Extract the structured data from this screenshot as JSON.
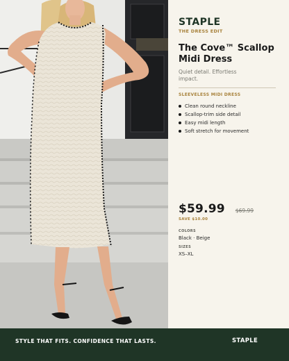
{
  "brand": "STAPLE",
  "edit_label": "THE DRESS EDIT",
  "product": {
    "title": "The Cove™ Scallop Midi Dress",
    "tagline": "Quiet detail. Effortless impact.",
    "category": "SLEEVELESS MIDI DRESS",
    "features": [
      "Clean round neckline",
      "Scallop-trim side detail",
      "Easy midi length",
      "Soft stretch for movement"
    ]
  },
  "pricing": {
    "price": "$59.99",
    "original_price": "$69.99",
    "savings": "SAVE $10.00"
  },
  "specs": {
    "colors_label": "COLORS",
    "colors_value": "Black · Beige",
    "sizes_label": "SIZES",
    "sizes_value": "XS–XL"
  },
  "footer": {
    "slogan": "STYLE THAT FITS. CONFIDENCE THAT LASTS.",
    "brand": "STAPLE"
  },
  "colors": {
    "brand_green": "#1f3526",
    "accent_gold": "#a7813a",
    "panel_background": "#f7f4ec"
  }
}
